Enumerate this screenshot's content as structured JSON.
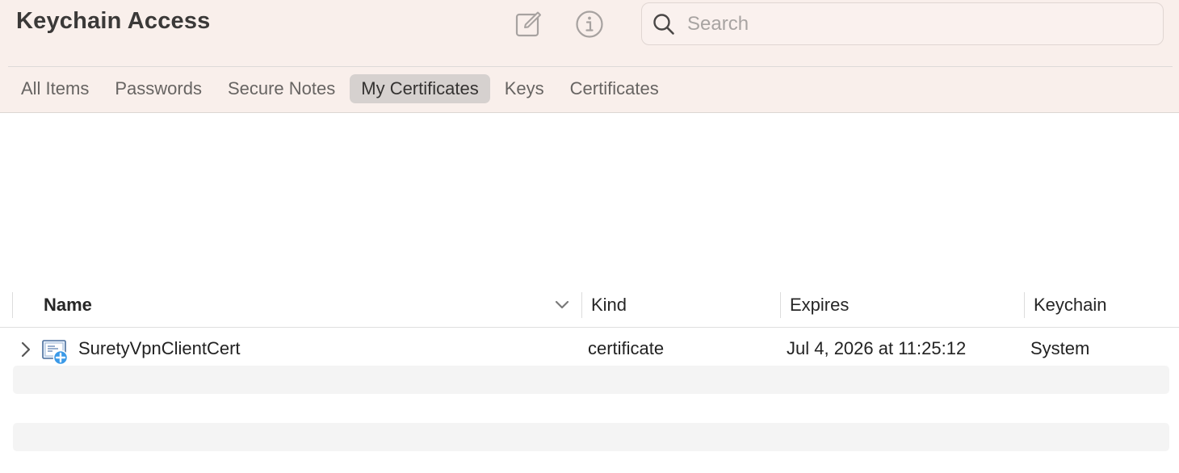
{
  "window": {
    "title": "Keychain Access"
  },
  "toolbar": {
    "compose_icon": "square-and-pencil-icon",
    "info_icon": "info-circle-icon",
    "search": {
      "icon": "magnifying-glass-icon",
      "placeholder": "Search",
      "value": ""
    }
  },
  "tabs": [
    {
      "label": "All Items",
      "selected": false
    },
    {
      "label": "Passwords",
      "selected": false
    },
    {
      "label": "Secure Notes",
      "selected": false
    },
    {
      "label": "My Certificates",
      "selected": true
    },
    {
      "label": "Keys",
      "selected": false
    },
    {
      "label": "Certificates",
      "selected": false
    }
  ],
  "table": {
    "columns": {
      "name": "Name",
      "kind": "Kind",
      "expires": "Expires",
      "keychain": "Keychain"
    },
    "sort_icon": "chevron-down-icon",
    "rows": [
      {
        "icon": "certificate-icon",
        "expand_icon": "chevron-right-icon",
        "name": "SuretyVpnClientCert",
        "kind": "certificate",
        "expires": "Jul 4, 2026 at 11:25:12",
        "keychain": "System"
      }
    ]
  },
  "colors": {
    "toolbar_background": "#f9efeb",
    "selected_tab_background": "#d6d1cf",
    "stripe_background": "#f4f4f4",
    "certificate_badge": "#3b9ae8"
  }
}
